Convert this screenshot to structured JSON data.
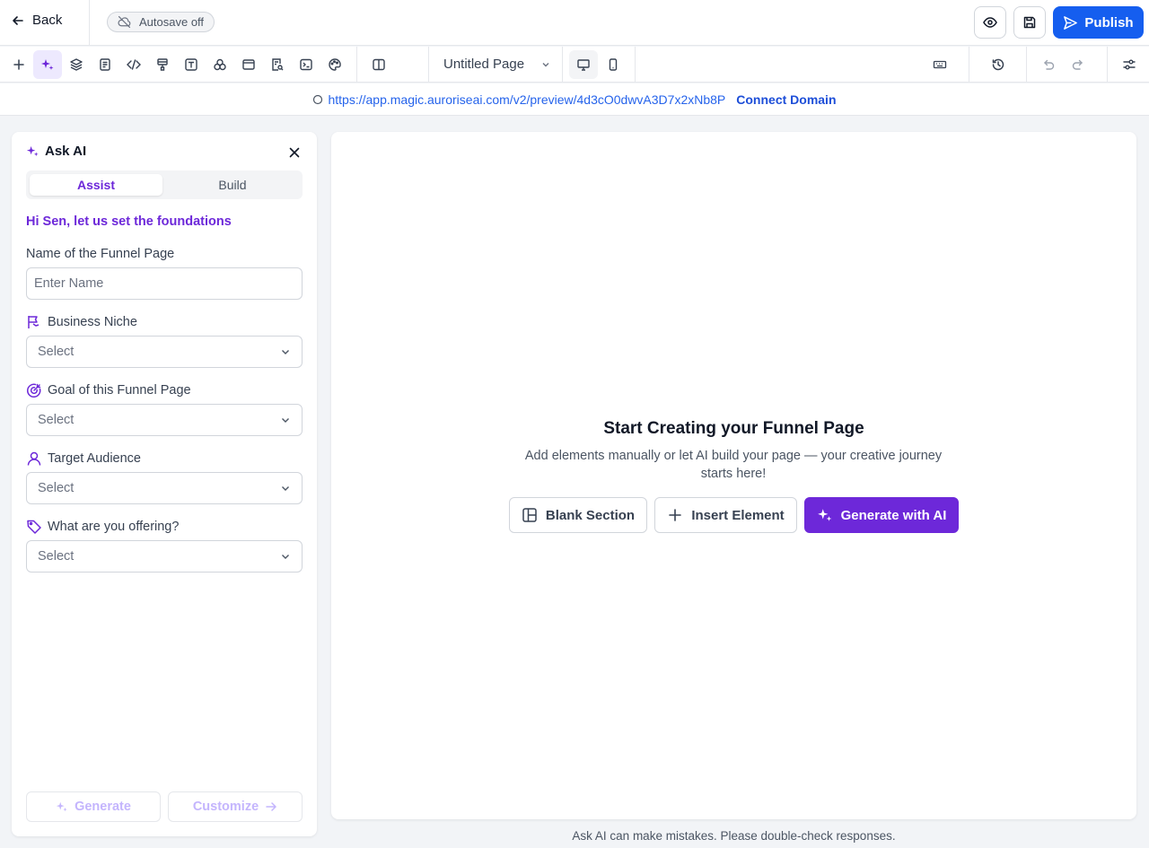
{
  "topbar": {
    "back_label": "Back",
    "autosave_label": "Autosave off",
    "publish_label": "Publish"
  },
  "toolbar": {
    "page_name": "Untitled Page",
    "left_icons": [
      "plus-icon",
      "sparkles-icon",
      "layers-icon",
      "page-icon",
      "code-icon",
      "paint-bucket-icon",
      "text-icon",
      "shapes-icon",
      "browser-icon",
      "search-doc-icon",
      "terminal-icon",
      "palette-icon"
    ],
    "right_icons": [
      "keyboard-icon",
      "history-icon",
      "undo-icon",
      "redo-icon",
      "settings-sliders-icon"
    ]
  },
  "urlbar": {
    "url": "https://app.magic.auroriseai.com/v2/preview/4d3cO0dwvA3D7x2xNb8P",
    "connect_label": "Connect Domain"
  },
  "panel": {
    "title": "Ask AI",
    "tabs": [
      {
        "label": "Assist"
      },
      {
        "label": "Build"
      }
    ],
    "greeting": "Hi Sen, let us set the foundations",
    "name_label": "Name of the Funnel Page",
    "name_placeholder": "Enter Name",
    "fields": [
      {
        "label": "Business Niche",
        "value": "Select",
        "icon": "flag-icon"
      },
      {
        "label": "Goal of this Funnel Page",
        "value": "Select",
        "icon": "target-icon"
      },
      {
        "label": "Target Audience",
        "value": "Select",
        "icon": "user-icon"
      },
      {
        "label": "What are you offering?",
        "value": "Select",
        "icon": "tag-icon"
      }
    ],
    "generate_label": "Generate",
    "customize_label": "Customize"
  },
  "canvas": {
    "title": "Start Creating your Funnel Page",
    "subtitle": "Add elements manually or let AI build your page — your creative journey starts here!",
    "blank_section_label": "Blank Section",
    "insert_element_label": "Insert Element",
    "generate_ai_label": "Generate with AI"
  },
  "disclaimer": "Ask AI can make mistakes. Please double-check responses.",
  "colors": {
    "accent_purple": "#6d28d9",
    "publish_blue": "#155eef",
    "link_blue": "#2563eb"
  }
}
